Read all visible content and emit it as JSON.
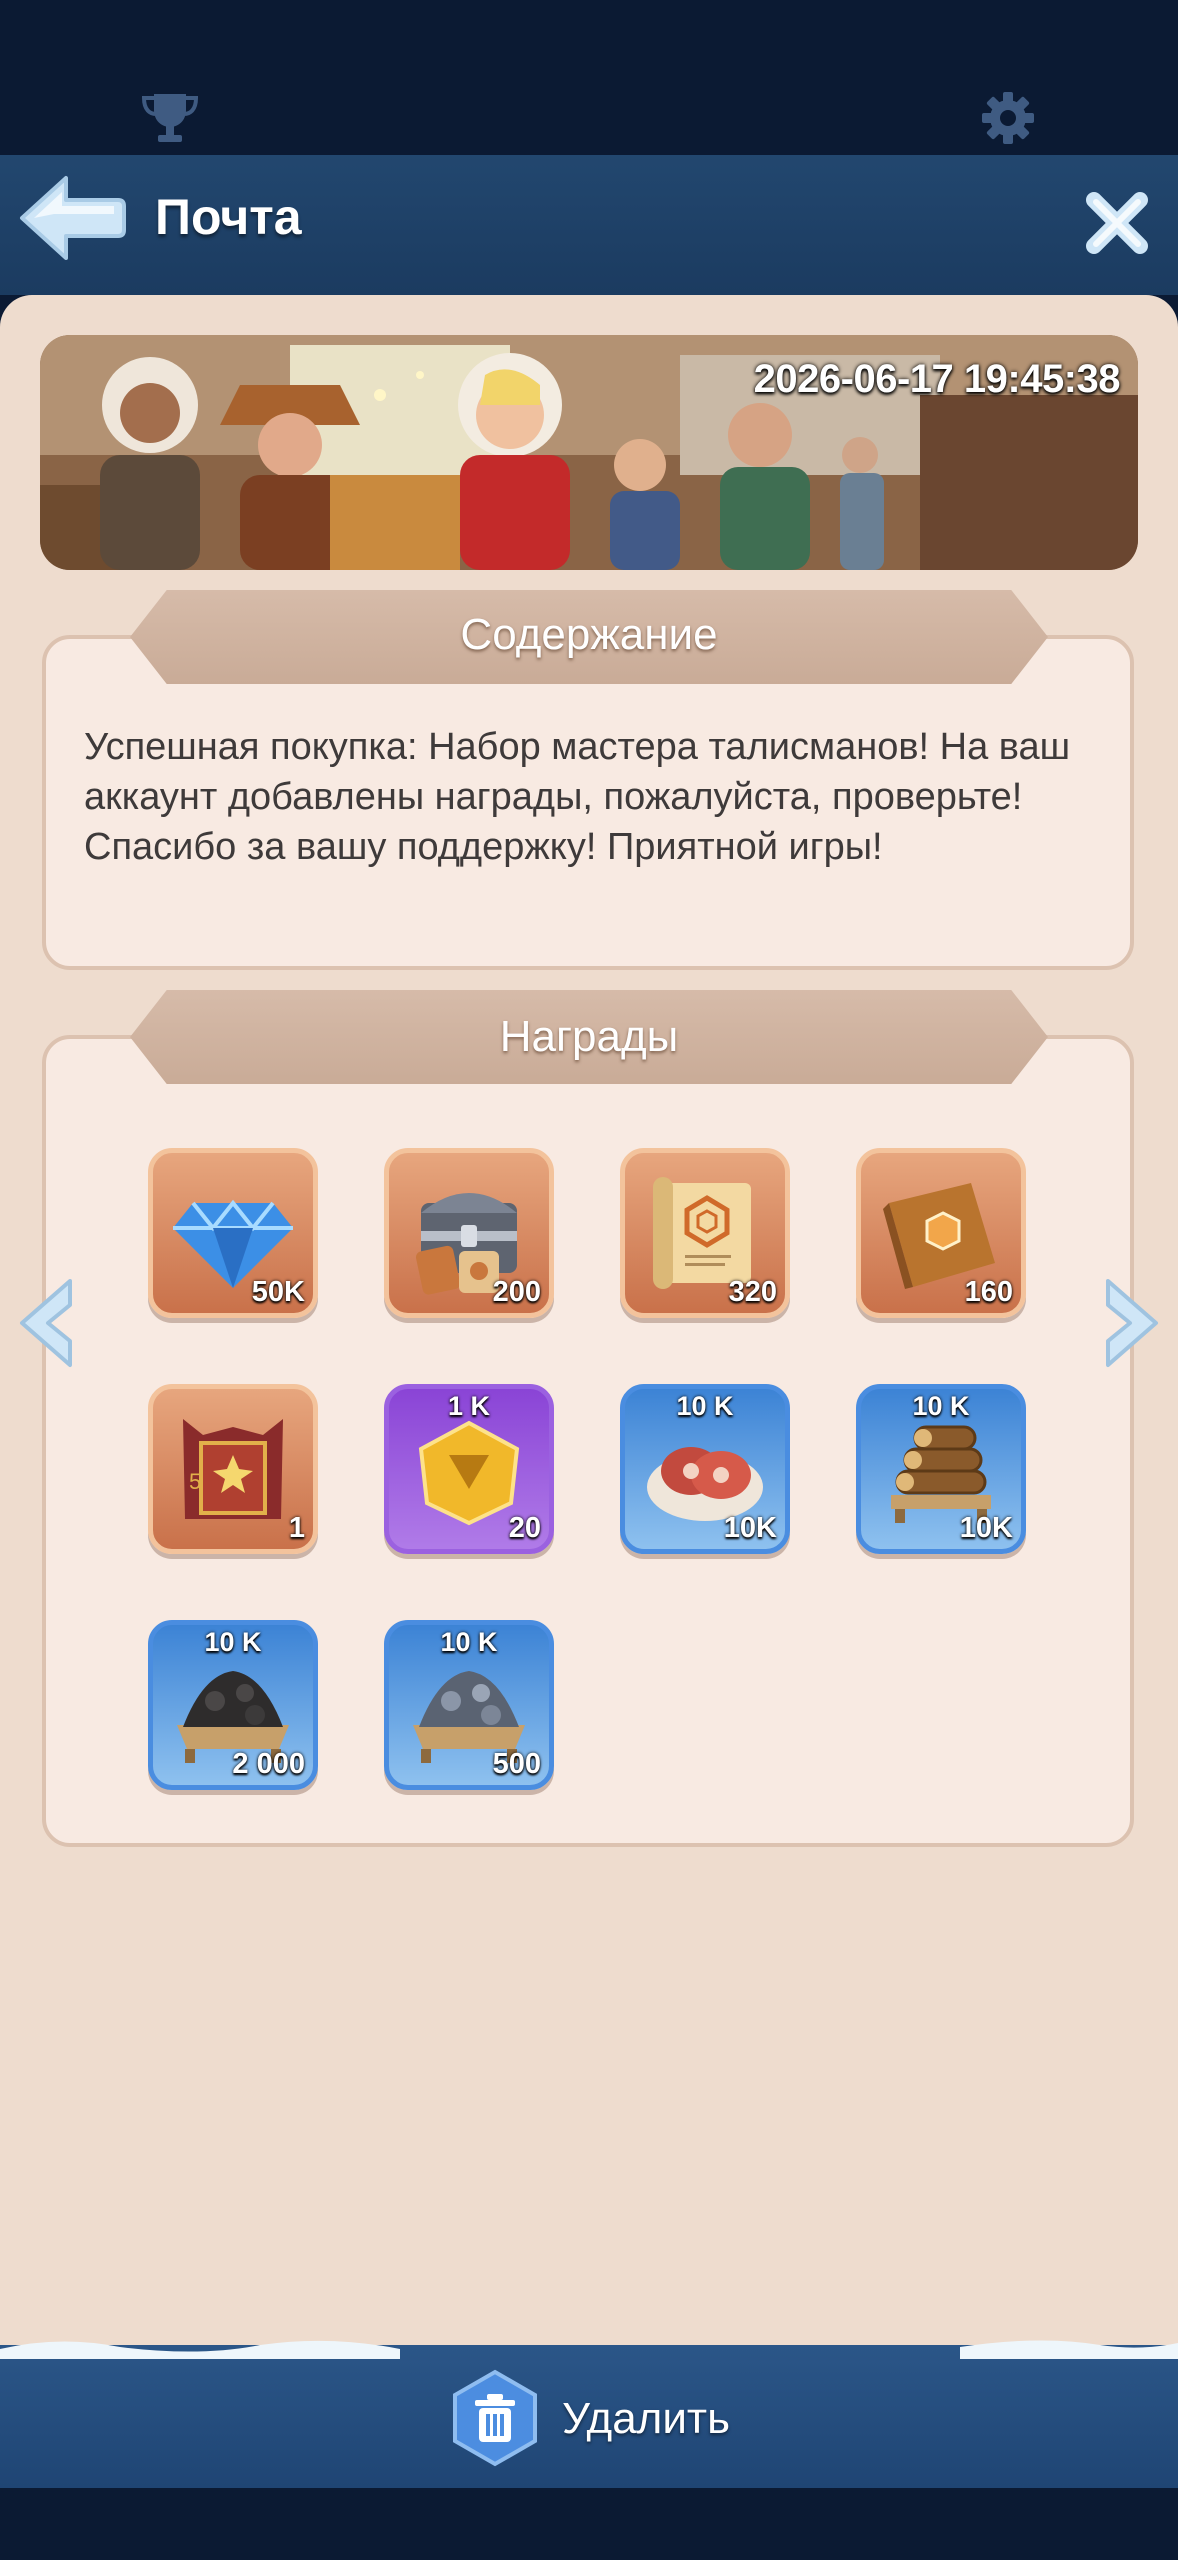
{
  "header": {
    "title": "Почта"
  },
  "banner": {
    "timestamp": "2026-06-17 19:45:38"
  },
  "content_section": {
    "heading": "Содержание",
    "text": "Успешная покупка: Набор мастера талисманов! На ваш аккаунт добавлены награды, пожалуйста, проверьте! Спасибо за вашу поддержку! Приятной игры!"
  },
  "rewards_section": {
    "heading": "Награды",
    "items": [
      {
        "icon": "gem-icon",
        "quantity": "50K",
        "cap": ""
      },
      {
        "icon": "chest-icon",
        "quantity": "200",
        "cap": ""
      },
      {
        "icon": "scroll-icon",
        "quantity": "320",
        "cap": ""
      },
      {
        "icon": "book-icon",
        "quantity": "160",
        "cap": ""
      },
      {
        "icon": "lantern-box-icon",
        "quantity": "1",
        "cap": ""
      },
      {
        "icon": "gold-hex-icon",
        "quantity": "20",
        "cap": "1 K"
      },
      {
        "icon": "meat-icon",
        "quantity": "10K",
        "cap": "10 K"
      },
      {
        "icon": "wood-icon",
        "quantity": "10K",
        "cap": "10 K"
      },
      {
        "icon": "coal-icon",
        "quantity": "2 000",
        "cap": "10 K"
      },
      {
        "icon": "iron-ore-icon",
        "quantity": "500",
        "cap": "10 K"
      }
    ]
  },
  "footer": {
    "delete_label": "Удалить"
  },
  "colors": {
    "panel": "#eedcce",
    "header": "#22476f",
    "accent_blue": "#3c83d5",
    "accent_orange": "#e7a67e",
    "accent_purple": "#8a44d6"
  }
}
